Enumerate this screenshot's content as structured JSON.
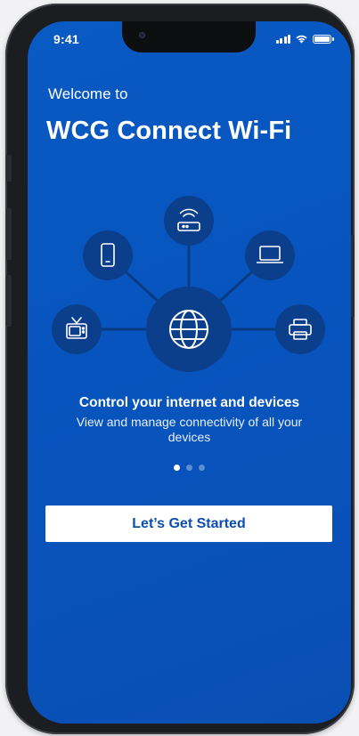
{
  "status": {
    "time": "9:41"
  },
  "hero": {
    "eyebrow": "Welcome to",
    "title": "WCG Connect Wi-Fi"
  },
  "illustration": {
    "hub_icon": "globe-icon",
    "devices": [
      "router-icon",
      "phone-icon",
      "laptop-icon",
      "tv-icon",
      "printer-icon"
    ]
  },
  "feature": {
    "title": "Control your internet and devices",
    "description": "View and manage connectivity of all your devices"
  },
  "pager": {
    "count": 3,
    "active": 1
  },
  "cta": {
    "label": "Let’s Get Started"
  },
  "colors": {
    "background": "#0754be",
    "button_text": "#0b4fae",
    "circle": "#0b3f8c"
  }
}
